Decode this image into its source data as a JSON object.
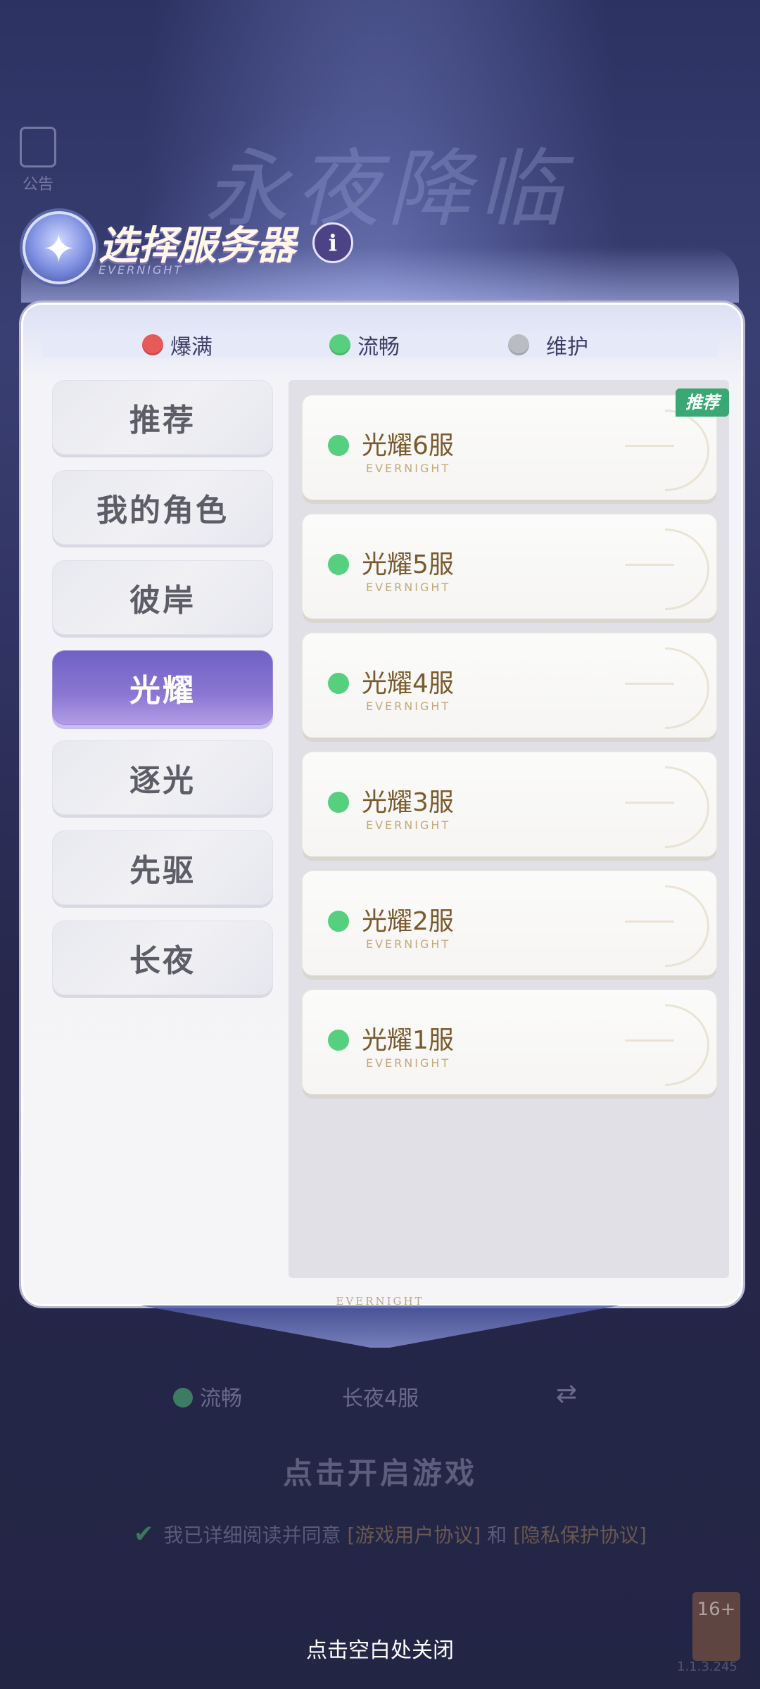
{
  "notice": {
    "label": "公告"
  },
  "background": {
    "logo_text": "永夜降临"
  },
  "dialog": {
    "title": "选择服务器",
    "title_sub": "EVERNIGHT",
    "footer_label": "EVERNIGHT"
  },
  "legend": [
    {
      "label": "爆满",
      "color": "#e85a5a"
    },
    {
      "label": "流畅",
      "color": "#56cf7e"
    },
    {
      "label": "维护",
      "color": "#b9bcc2"
    }
  ],
  "tabs": [
    {
      "label": "推荐",
      "active": false
    },
    {
      "label": "我的角色",
      "active": false
    },
    {
      "label": "彼岸",
      "active": false
    },
    {
      "label": "光耀",
      "active": true
    },
    {
      "label": "逐光",
      "active": false
    },
    {
      "label": "先驱",
      "active": false
    },
    {
      "label": "长夜",
      "active": false
    }
  ],
  "servers": [
    {
      "name": "光耀6服",
      "sub": "EVERNIGHT",
      "status": "流畅"
    },
    {
      "name": "光耀5服",
      "sub": "EVERNIGHT",
      "status": "流畅"
    },
    {
      "name": "光耀4服",
      "sub": "EVERNIGHT",
      "status": "流畅"
    },
    {
      "name": "光耀3服",
      "sub": "EVERNIGHT",
      "status": "流畅"
    },
    {
      "name": "光耀2服",
      "sub": "EVERNIGHT",
      "status": "流畅"
    },
    {
      "name": "光耀1服",
      "sub": "EVERNIGHT",
      "status": "流畅"
    }
  ],
  "recommend_badge": "推荐",
  "footer": {
    "status_label": "流畅",
    "current_server": "长夜4服",
    "start_game": "点击开启游戏",
    "agree_prefix": "我已详细阅读并同意",
    "agree_link1": "[游戏用户协议]",
    "agree_and": "和",
    "agree_link2": "[隐私保护协议]",
    "age_rating": "16+",
    "version": "1.1.3.245",
    "close_hint": "点击空白处关闭"
  }
}
